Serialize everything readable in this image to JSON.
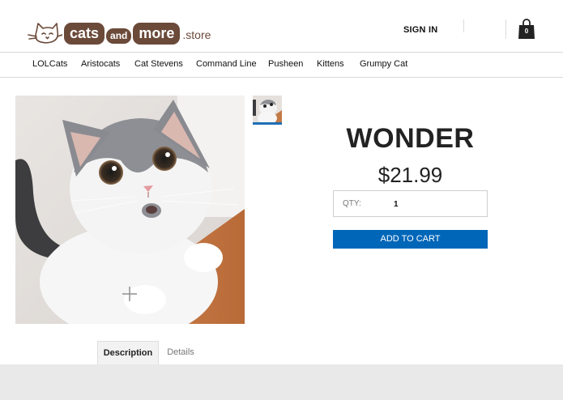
{
  "header": {
    "logo": {
      "word1": "cats",
      "word2": "and",
      "word3": "more",
      "suffix": ".store"
    },
    "signin_label": "SIGN IN",
    "cart_count": "0"
  },
  "nav": {
    "items": [
      {
        "label": "LOLCats"
      },
      {
        "label": "Aristocats"
      },
      {
        "label": "Cat Stevens"
      },
      {
        "label": "Command Line"
      },
      {
        "label": "Pusheen"
      },
      {
        "label": "Kittens"
      },
      {
        "label": "Grumpy Cat"
      }
    ]
  },
  "product": {
    "title": "WONDER",
    "price": "$21.99",
    "qty_label": "QTY:",
    "qty_value": "1",
    "add_to_cart_label": "ADD TO CART"
  },
  "tabs": [
    {
      "label": "Description",
      "active": true
    },
    {
      "label": "Details",
      "active": false
    }
  ],
  "colors": {
    "brand": "#6b4a3a",
    "accent": "#0066b8",
    "footer": "#e9e9ea"
  },
  "icons": [
    "cat-logo-icon",
    "shopping-bag-icon",
    "zoom-plus-icon"
  ]
}
